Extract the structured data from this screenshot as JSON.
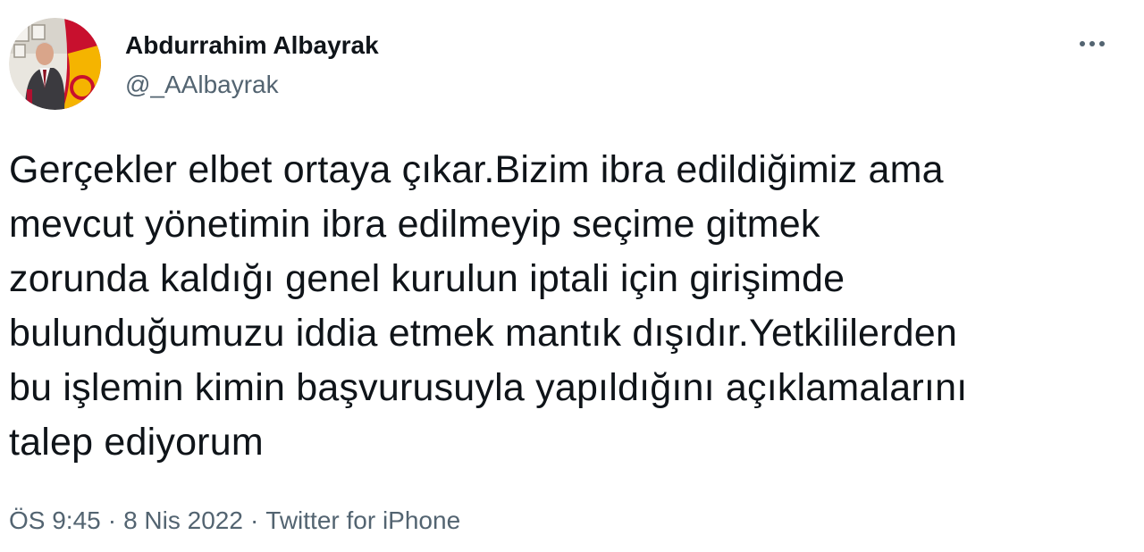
{
  "author": {
    "display_name": "Abdurrahim Albayrak",
    "handle": "@_AAlbayrak"
  },
  "menu": {
    "icon": "more-horizontal-icon"
  },
  "tweet": {
    "lines": [
      "Gerçekler elbet ortaya çıkar.Bizim ibra edildiğimiz ama",
      "mevcut yönetimin ibra edilmeyip seçime gitmek",
      "zorunda kaldığı genel kurulun iptali için girişimde",
      "bulunduğumuzu iddia etmek mantık dışıdır.Yetkililerden",
      "bu işlemin kimin başvurusuyla yapıldığını açıklamalarını",
      "talep ediyorum"
    ]
  },
  "meta": {
    "time": "ÖS 9:45",
    "date": "8 Nis 2022",
    "source": "Twitter for iPhone",
    "separator": "·"
  },
  "colors": {
    "text_primary": "#0f1419",
    "text_secondary": "#536471",
    "background": "#ffffff"
  }
}
